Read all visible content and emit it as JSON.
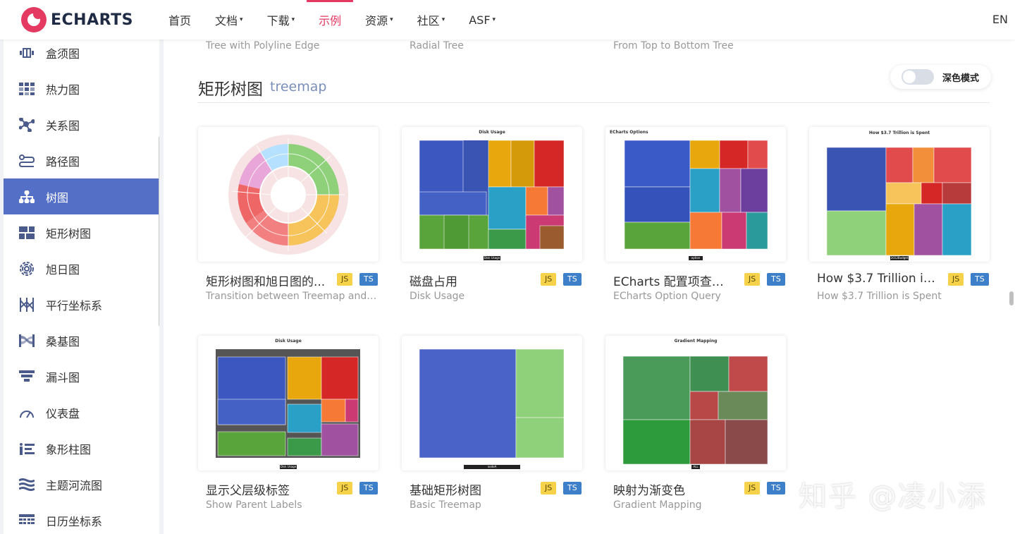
{
  "nav": {
    "logo_text": "ECHARTS",
    "items": [
      {
        "label": "首页",
        "caret": ""
      },
      {
        "label": "文档",
        "caret": "▾"
      },
      {
        "label": "下载",
        "caret": "▾"
      },
      {
        "label": "示例",
        "caret": ""
      },
      {
        "label": "资源",
        "caret": "▾"
      },
      {
        "label": "社区",
        "caret": "▾"
      },
      {
        "label": "ASF",
        "caret": "▾"
      }
    ],
    "active_item": "示例",
    "lang": "EN",
    "accent_color": "#e43961"
  },
  "sidebar": {
    "items": [
      {
        "label": "盒须图",
        "icon": "boxplot-icon"
      },
      {
        "label": "热力图",
        "icon": "heatmap-icon"
      },
      {
        "label": "关系图",
        "icon": "graph-icon"
      },
      {
        "label": "路径图",
        "icon": "lines-icon"
      },
      {
        "label": "树图",
        "icon": "tree-icon"
      },
      {
        "label": "矩形树图",
        "icon": "treemap-icon"
      },
      {
        "label": "旭日图",
        "icon": "sunburst-icon"
      },
      {
        "label": "平行坐标系",
        "icon": "parallel-icon"
      },
      {
        "label": "桑基图",
        "icon": "sankey-icon"
      },
      {
        "label": "漏斗图",
        "icon": "funnel-icon"
      },
      {
        "label": "仪表盘",
        "icon": "gauge-icon"
      },
      {
        "label": "象形柱图",
        "icon": "pictorialbar-icon"
      },
      {
        "label": "主题河流图",
        "icon": "themeriver-icon"
      },
      {
        "label": "日历坐标系",
        "icon": "calendar-icon"
      }
    ],
    "active_item": "树图",
    "active_color": "#5470c6"
  },
  "previous_row": {
    "captions": [
      "Tree with Polyline Edge",
      "Radial Tree",
      "From Top to Bottom Tree"
    ]
  },
  "section": {
    "title": "矩形树图",
    "subtitle": "treemap"
  },
  "dark_mode": {
    "label": "深色模式",
    "enabled": false
  },
  "cards": [
    {
      "title": "矩形树图和旭日图的...",
      "subtitle": "Transition between Treemap and Su...",
      "js": "JS",
      "ts": "TS",
      "thumb": "sunburst"
    },
    {
      "title": "磁盘占用",
      "subtitle": "Disk Usage",
      "js": "JS",
      "ts": "TS",
      "thumb": "disk",
      "thumb_title": "Disk Usage",
      "thumb_footer": "Disk Usage"
    },
    {
      "title": "ECharts 配置项查询分...",
      "subtitle": "ECharts Option Query",
      "js": "JS",
      "ts": "TS",
      "thumb": "option",
      "thumb_title": "ECharts Options",
      "thumb_footer": "option"
    },
    {
      "title": "How $3.7 Trillion is S...",
      "subtitle": "How $3.7 Trillion is Spent",
      "js": "JS",
      "ts": "TS",
      "thumb": "trillion",
      "thumb_title": "How $3.7 Trillion is Spent",
      "thumb_footer": "2012Budget"
    },
    {
      "title": "显示父层级标签",
      "subtitle": "Show Parent Labels",
      "js": "JS",
      "ts": "TS",
      "thumb": "parent",
      "thumb_title": "Disk Usage",
      "thumb_footer": "Disk Usage"
    },
    {
      "title": "基础矩形树图",
      "subtitle": "Basic Treemap",
      "js": "JS",
      "ts": "TS",
      "thumb": "basic",
      "thumb_footer": "nodeA"
    },
    {
      "title": "映射为渐变色",
      "subtitle": "Gradient Mapping",
      "js": "JS",
      "ts": "TS",
      "thumb": "gradient",
      "thumb_title": "Gradient Mapping",
      "thumb_footer": "ALL"
    }
  ],
  "watermark": "知乎 @凌小添"
}
